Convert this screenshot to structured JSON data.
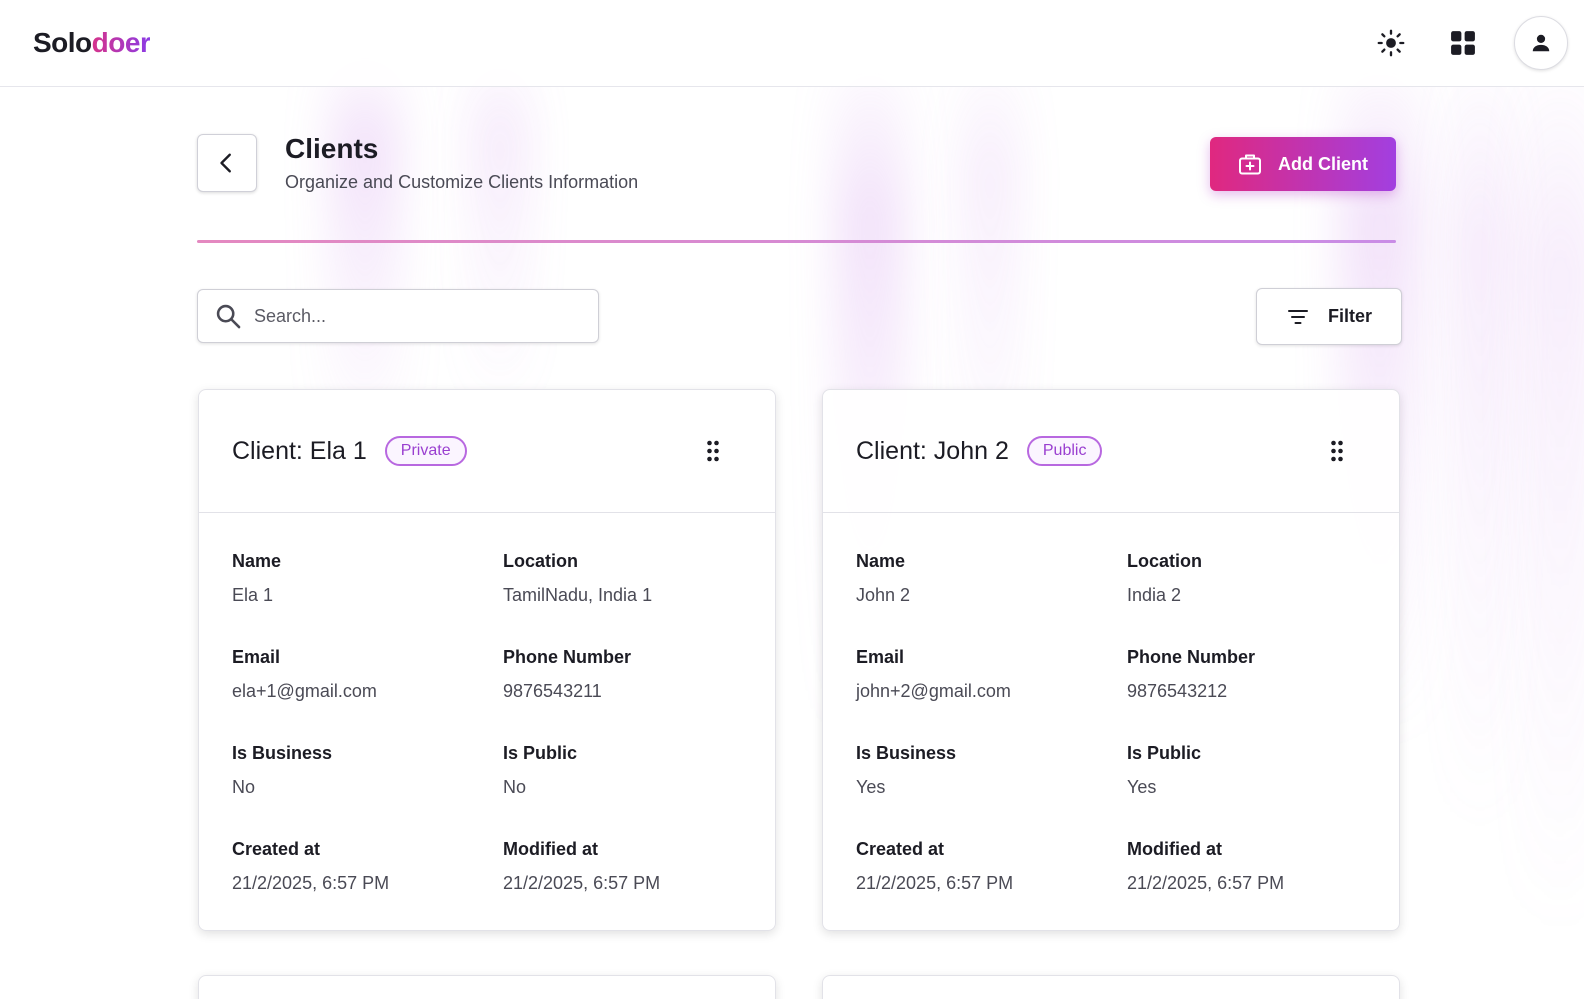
{
  "brand": {
    "part1": "Solo",
    "part2": "doer"
  },
  "header": {
    "theme_icon": "sun-icon",
    "apps_icon": "grid-icon",
    "profile_icon": "user-icon"
  },
  "page": {
    "title": "Clients",
    "subtitle": "Organize and Customize Clients Information",
    "add_label": "Add Client"
  },
  "search": {
    "placeholder": "Search...",
    "value": ""
  },
  "filter": {
    "label": "Filter"
  },
  "labels": {
    "name": "Name",
    "location": "Location",
    "email": "Email",
    "phone": "Phone Number",
    "is_business": "Is Business",
    "is_public": "Is Public",
    "created": "Created at",
    "modified": "Modified at"
  },
  "clients": [
    {
      "title": "Client: Ela 1",
      "badge": "Private",
      "name": "Ela 1",
      "location": "TamilNadu, India 1",
      "email": "ela+1@gmail.com",
      "phone": "9876543211",
      "is_business": "No",
      "is_public": "No",
      "created": "21/2/2025, 6:57 PM",
      "modified": "21/2/2025, 6:57 PM"
    },
    {
      "title": "Client: John 2",
      "badge": "Public",
      "name": "John 2",
      "location": "India 2",
      "email": "john+2@gmail.com",
      "phone": "9876543212",
      "is_business": "Yes",
      "is_public": "Yes",
      "created": "21/2/2025, 6:57 PM",
      "modified": "21/2/2025, 6:57 PM"
    }
  ],
  "colors": {
    "accent_start": "#e0287f",
    "accent_end": "#a23fe0",
    "badge": "#9a3fd0"
  }
}
